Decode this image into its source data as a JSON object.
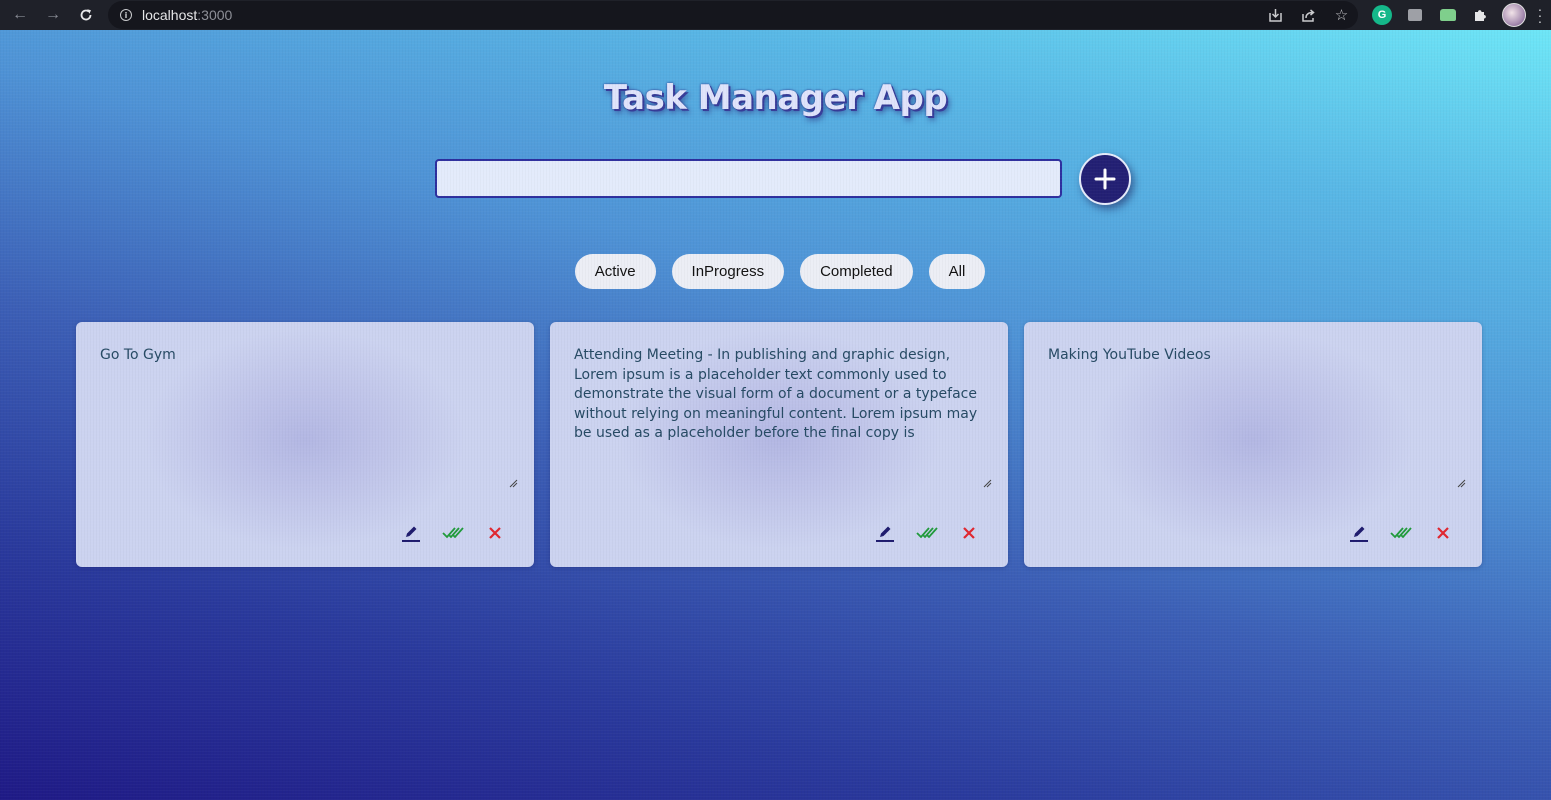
{
  "browser": {
    "url_host": "localhost",
    "url_port": ":3000",
    "icons": [
      "back-arrow-icon",
      "forward-arrow-icon",
      "reload-icon",
      "site-info-icon",
      "install-icon",
      "share-icon",
      "bookmark-star-icon",
      "grammarly-extension-icon",
      "extension-icon",
      "extension-icon",
      "extensions-puzzle-icon",
      "profile-avatar",
      "more-menu-icon"
    ],
    "grammarly_letter": "G"
  },
  "app": {
    "title": "Task Manager App",
    "input": {
      "value": "",
      "placeholder": ""
    },
    "add_button_icon": "plus-icon"
  },
  "filters": [
    {
      "label": "Active"
    },
    {
      "label": "InProgress"
    },
    {
      "label": "Completed"
    },
    {
      "label": "All"
    }
  ],
  "tasks": [
    {
      "text": "Go To Gym"
    },
    {
      "text": "Attending Meeting - In publishing and graphic design, Lorem ipsum is a placeholder text commonly used to demonstrate the visual form of a document or a typeface without relying on meaningful content. Lorem ipsum may be used as a placeholder before the final copy is"
    },
    {
      "text": "Making YouTube Videos"
    }
  ],
  "task_actions": {
    "edit_icon": "pencil-icon",
    "complete_icon": "double-check-icon",
    "delete_icon": "close-x-icon"
  },
  "colors": {
    "accent_dark": "#232074",
    "edit": "#1e1b6e",
    "complete": "#1f9b3a",
    "delete": "#e0262f",
    "task_text": "#264a64"
  }
}
